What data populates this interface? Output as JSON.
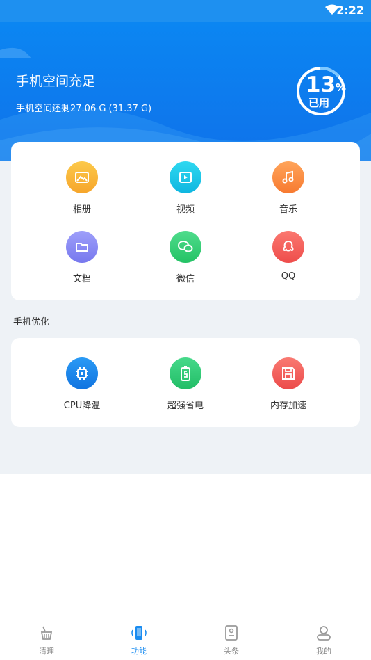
{
  "status_bar": {
    "time": "2:22"
  },
  "storage": {
    "title": "手机空间充足",
    "detail": "手机空间还剩27.06 G (31.37 G)",
    "used_percent": "13",
    "percent_sign": "%",
    "used_label": "已用"
  },
  "categories": [
    {
      "label": "相册",
      "icon": "photo-icon",
      "color": "#f6b93c"
    },
    {
      "label": "视频",
      "icon": "video-icon",
      "color": "#17c6e6"
    },
    {
      "label": "音乐",
      "icon": "music-icon",
      "color": "#fc8f42"
    },
    {
      "label": "文档",
      "icon": "folder-icon",
      "color": "#8b8cf5"
    },
    {
      "label": "微信",
      "icon": "wechat-icon",
      "color": "#35d078"
    },
    {
      "label": "QQ",
      "icon": "qq-icon",
      "color": "#f4615c"
    }
  ],
  "optimize": {
    "title": "手机优化",
    "items": [
      {
        "label": "CPU降温",
        "icon": "cpu-icon",
        "color": "#1c8cf0"
      },
      {
        "label": "超强省电",
        "icon": "battery-icon",
        "color": "#33cc77"
      },
      {
        "label": "内存加速",
        "icon": "memory-icon",
        "color": "#f25c5c"
      }
    ]
  },
  "tabs": [
    {
      "label": "清理",
      "icon": "broom-icon",
      "active": false
    },
    {
      "label": "功能",
      "icon": "phone-icon",
      "active": true
    },
    {
      "label": "头条",
      "icon": "news-icon",
      "active": false
    },
    {
      "label": "我的",
      "icon": "user-icon",
      "active": false
    }
  ],
  "colors": {
    "primary": "#1a8cf0",
    "gray_bg": "#eef2f6"
  }
}
